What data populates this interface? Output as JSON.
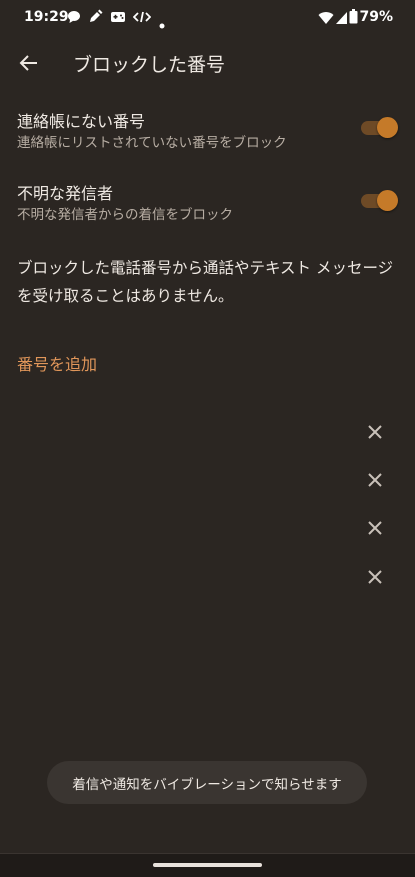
{
  "status_bar": {
    "time": "19:29",
    "notification_icons": [
      "chat-icon",
      "pen-icon",
      "gamepad-icon",
      "code-icon",
      "dot-icon"
    ],
    "battery_percent": "79%"
  },
  "app_bar": {
    "title": "ブロックした番号"
  },
  "settings": [
    {
      "title": "連絡帳にない番号",
      "subtitle": "連絡帳にリストされていない番号をブロック",
      "enabled": true
    },
    {
      "title": "不明な発信者",
      "subtitle": "不明な発信者からの着信をブロック",
      "enabled": true
    }
  ],
  "info_text": "ブロックした電話番号から通話やテキスト メッセージを受け取ることはありません。",
  "add_number_label": "番号を追加",
  "blocked_entries_count": 4,
  "toast": "着信や通知をバイブレーションで知らせます",
  "colors": {
    "background": "#2b2622",
    "accent": "#e0965a",
    "toggle_thumb": "#c57a29",
    "toggle_track": "#6e4a26"
  }
}
